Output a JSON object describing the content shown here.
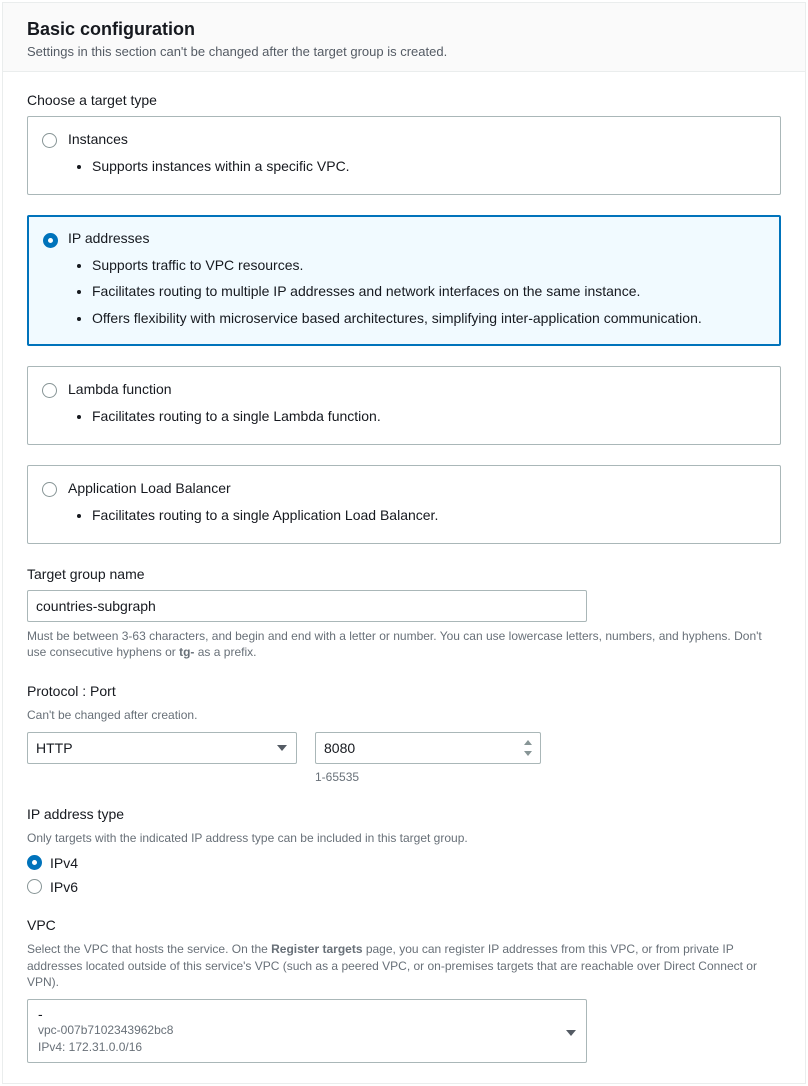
{
  "header": {
    "title": "Basic configuration",
    "subtitle": "Settings in this section can't be changed after the target group is created."
  },
  "targetType": {
    "label": "Choose a target type",
    "options": [
      {
        "title": "Instances",
        "bullets": [
          "Supports instances within a specific VPC."
        ]
      },
      {
        "title": "IP addresses",
        "bullets": [
          "Supports traffic to VPC resources.",
          "Facilitates routing to multiple IP addresses and network interfaces on the same instance.",
          "Offers flexibility with microservice based architectures, simplifying inter-application communication."
        ]
      },
      {
        "title": "Lambda function",
        "bullets": [
          "Facilitates routing to a single Lambda function."
        ]
      },
      {
        "title": "Application Load Balancer",
        "bullets": [
          "Facilitates routing to a single Application Load Balancer."
        ]
      }
    ],
    "selectedIndex": 1
  },
  "targetGroupName": {
    "label": "Target group name",
    "value": "countries-subgraph",
    "helper_pre": "Must be between 3-63 characters, and begin and end with a letter or number. You can use lowercase letters, numbers, and hyphens. Don't use consecutive hyphens or ",
    "helper_bold": "tg-",
    "helper_post": " as a prefix."
  },
  "protocolPort": {
    "label": "Protocol : Port",
    "sublabel": "Can't be changed after creation.",
    "protocolValue": "HTTP",
    "portValue": "8080",
    "portRange": "1-65535"
  },
  "ipType": {
    "label": "IP address type",
    "sublabel": "Only targets with the indicated IP address type can be included in this target group.",
    "options": [
      "IPv4",
      "IPv6"
    ],
    "selectedIndex": 0
  },
  "vpc": {
    "label": "VPC",
    "helper_pre": "Select the VPC that hosts the service. On the ",
    "helper_bold": "Register targets",
    "helper_post": " page, you can register IP addresses from this VPC, or from private IP addresses located outside of this service's VPC (such as a peered VPC, or on-premises targets that are reachable over Direct Connect or VPN).",
    "selected": {
      "name": "-",
      "id": "vpc-007b7102343962bc8",
      "cidr": "IPv4: 172.31.0.0/16"
    }
  }
}
